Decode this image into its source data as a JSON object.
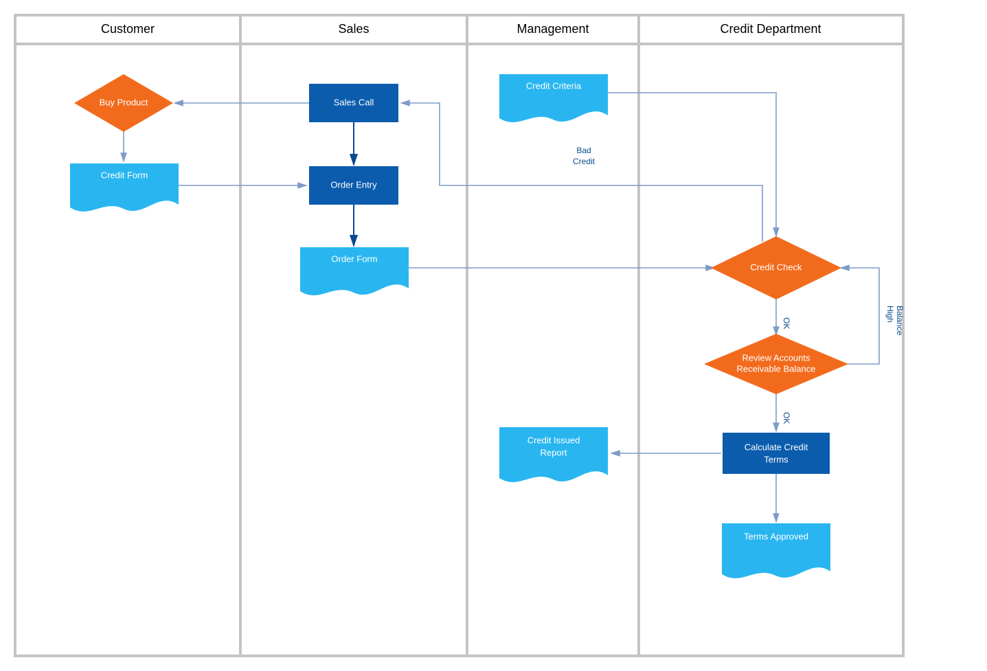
{
  "lanes": {
    "customer": "Customer",
    "sales": "Sales",
    "management": "Management",
    "credit_dept": "Credit Department"
  },
  "nodes": {
    "buy_product": "Buy Product",
    "credit_form": "Credit Form",
    "sales_call": "Sales Call",
    "order_entry": "Order Entry",
    "order_form": "Order Form",
    "credit_criteria": "Credit Criteria",
    "credit_check": "Credit Check",
    "review_accounts_l1": "Review Accounts",
    "review_accounts_l2": "Receivable Balance",
    "calc_credit_l1": "Calculate Credit",
    "calc_credit_l2": "Terms",
    "credit_issued_l1": "Credit Issued",
    "credit_issued_l2": "Report",
    "terms_approved": "Terms Approved"
  },
  "edge_labels": {
    "bad_credit_l1": "Bad",
    "bad_credit_l2": "Credit",
    "ok1": "OK",
    "ok2": "OK",
    "high_l1": "High",
    "high_l2": "Balance"
  },
  "colors": {
    "lane_border": "#c4c4c4",
    "process_fill": "#0b5cad",
    "decision_fill": "#f26b1d",
    "document_fill": "#29b6f0",
    "arrow": "#7f9bc8",
    "arrow_dark": "#0b4a8f"
  }
}
